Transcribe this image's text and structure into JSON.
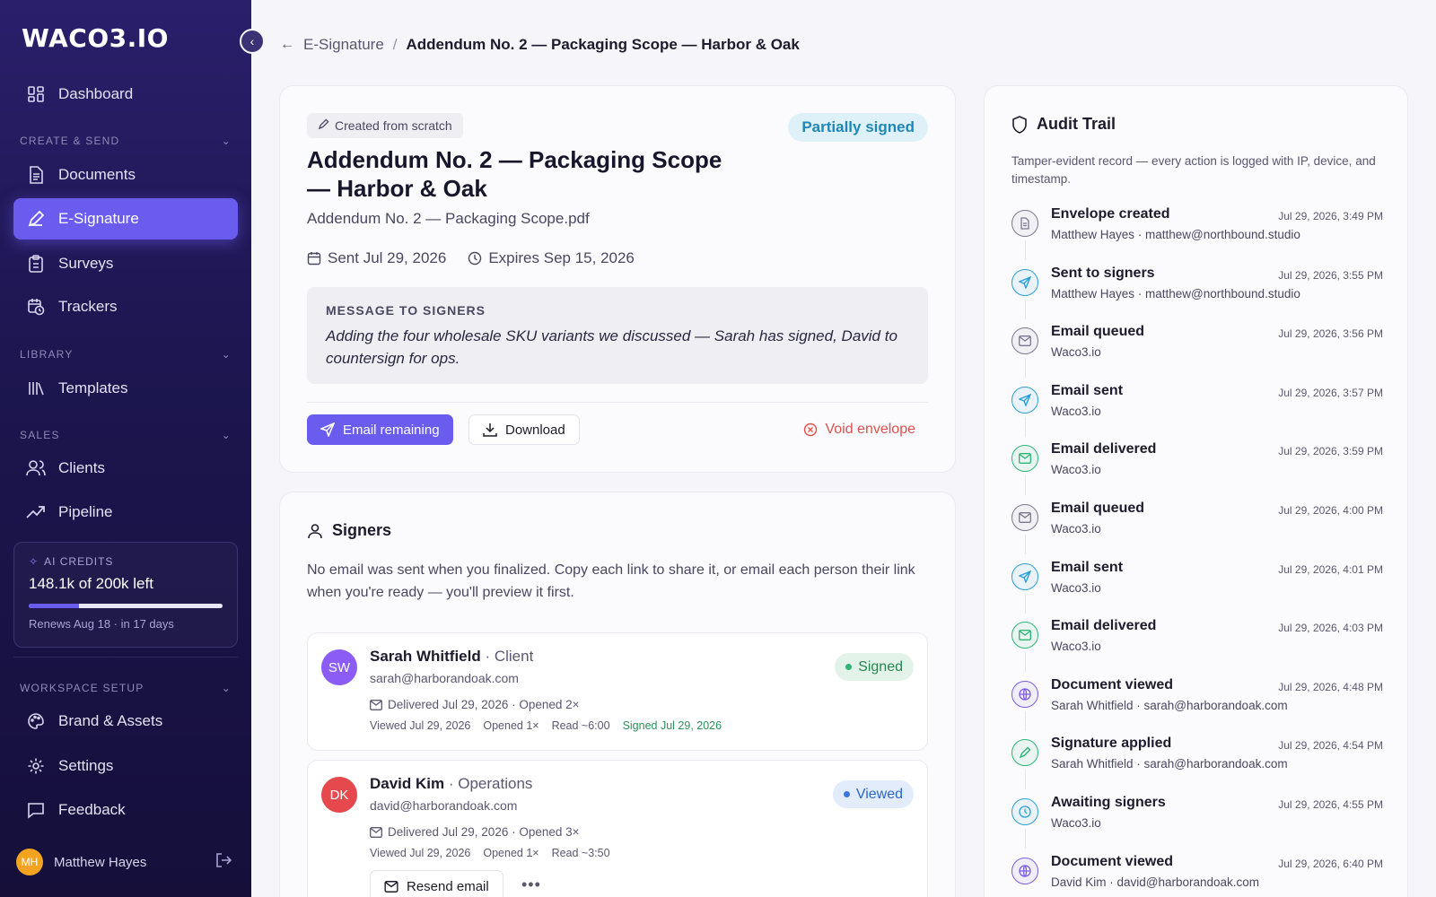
{
  "app": {
    "logo": "WACO3.IO"
  },
  "sidebar": {
    "nav": [
      {
        "id": "dashboard",
        "label": "Dashboard"
      },
      {
        "id": "documents",
        "label": "Documents"
      },
      {
        "id": "esignature",
        "label": "E-Signature"
      },
      {
        "id": "surveys",
        "label": "Surveys"
      },
      {
        "id": "trackers",
        "label": "Trackers"
      },
      {
        "id": "templates",
        "label": "Templates"
      },
      {
        "id": "clients",
        "label": "Clients"
      },
      {
        "id": "pipeline",
        "label": "Pipeline"
      },
      {
        "id": "brand",
        "label": "Brand & Assets"
      },
      {
        "id": "settings",
        "label": "Settings"
      },
      {
        "id": "feedback",
        "label": "Feedback"
      }
    ],
    "sections": {
      "create": "CREATE & SEND",
      "library": "LIBRARY",
      "sales": "SALES",
      "workspace": "WORKSPACE SETUP"
    },
    "credits": {
      "label": "AI CREDITS",
      "value": "148.1k of 200k left",
      "fraction": 0.26,
      "renews": "Renews Aug 18 · in 17 days"
    },
    "user": {
      "initials": "MH",
      "name": "Matthew Hayes"
    }
  },
  "breadcrumb": {
    "parent": "E-Signature",
    "sep": "/",
    "current": "Addendum No. 2 — Packaging Scope — Harbor & Oak"
  },
  "document": {
    "chip": "Created from scratch",
    "status": "Partially signed",
    "title": "Addendum No. 2 — Packaging Scope — Harbor & Oak",
    "file": "Addendum No. 2 — Packaging Scope.pdf",
    "sent": "Sent Jul 29, 2026",
    "expires": "Expires Sep 15, 2026",
    "message_label": "MESSAGE TO SIGNERS",
    "message": "Adding the four wholesale SKU variants we discussed — Sarah has signed, David to countersign for ops.",
    "actions": {
      "email_remaining": "Email remaining",
      "download": "Download",
      "void": "Void envelope"
    }
  },
  "signers": {
    "title": "Signers",
    "description": "No email was sent when you finalized. Copy each link to share it, or email each person their link when you're ready — you'll preview it first.",
    "items": [
      {
        "initials": "SW",
        "name": "Sarah Whitfield",
        "role": "· Client",
        "email": "sarah@harborandoak.com",
        "delivered": "Delivered Jul 29, 2026 · Opened 2×",
        "viewed": "Viewed Jul 29, 2026",
        "opened": "Opened 1×",
        "read": "Read ~6:00",
        "signed": "Signed Jul 29, 2026",
        "status": "Signed",
        "color": "#8b5cf6"
      },
      {
        "initials": "DK",
        "name": "David Kim",
        "role": "· Operations",
        "email": "david@harborandoak.com",
        "delivered": "Delivered Jul 29, 2026 · Opened 3×",
        "viewed": "Viewed Jul 29, 2026",
        "opened": "Opened 1×",
        "read": "Read ~3:50",
        "status": "Viewed",
        "color": "#e5484d",
        "resend": "Resend email",
        "more": "•••"
      }
    ]
  },
  "audit": {
    "title": "Audit Trail",
    "description": "Tamper-evident record — every action is logged with IP, device, and timestamp.",
    "items": [
      {
        "title": "Envelope created",
        "sub": "Matthew Hayes · matthew@northbound.studio",
        "time": "Jul 29, 2026, 3:49 PM",
        "icon": "document-icon",
        "color": "#7a7790"
      },
      {
        "title": "Sent to signers",
        "sub": "Matthew Hayes · matthew@northbound.studio",
        "time": "Jul 29, 2026, 3:55 PM",
        "icon": "send-icon",
        "color": "#2a9fd6"
      },
      {
        "title": "Email queued",
        "sub": "Waco3.io",
        "time": "Jul 29, 2026, 3:56 PM",
        "icon": "mail-icon",
        "color": "#7a7790"
      },
      {
        "title": "Email sent",
        "sub": "Waco3.io",
        "time": "Jul 29, 2026, 3:57 PM",
        "icon": "send-icon",
        "color": "#2a9fd6"
      },
      {
        "title": "Email delivered",
        "sub": "Waco3.io",
        "time": "Jul 29, 2026, 3:59 PM",
        "icon": "mail-icon",
        "color": "#2bb673"
      },
      {
        "title": "Email queued",
        "sub": "Waco3.io",
        "time": "Jul 29, 2026, 4:00 PM",
        "icon": "mail-icon",
        "color": "#7a7790"
      },
      {
        "title": "Email sent",
        "sub": "Waco3.io",
        "time": "Jul 29, 2026, 4:01 PM",
        "icon": "send-icon",
        "color": "#2a9fd6"
      },
      {
        "title": "Email delivered",
        "sub": "Waco3.io",
        "time": "Jul 29, 2026, 4:03 PM",
        "icon": "mail-icon",
        "color": "#2bb673"
      },
      {
        "title": "Document viewed",
        "sub": "Sarah Whitfield · sarah@harborandoak.com",
        "time": "Jul 29, 2026, 4:48 PM",
        "icon": "globe-icon",
        "color": "#7c5ce0"
      },
      {
        "title": "Signature applied",
        "sub": "Sarah Whitfield · sarah@harborandoak.com",
        "time": "Jul 29, 2026, 4:54 PM",
        "icon": "pen-icon",
        "color": "#2bb673"
      },
      {
        "title": "Awaiting signers",
        "sub": "Waco3.io",
        "time": "Jul 29, 2026, 4:55 PM",
        "icon": "clock-icon",
        "color": "#2a9fd6"
      },
      {
        "title": "Document viewed",
        "sub": "David Kim · david@harborandoak.com",
        "time": "Jul 29, 2026, 6:40 PM",
        "icon": "globe-icon",
        "color": "#7c5ce0"
      }
    ]
  }
}
